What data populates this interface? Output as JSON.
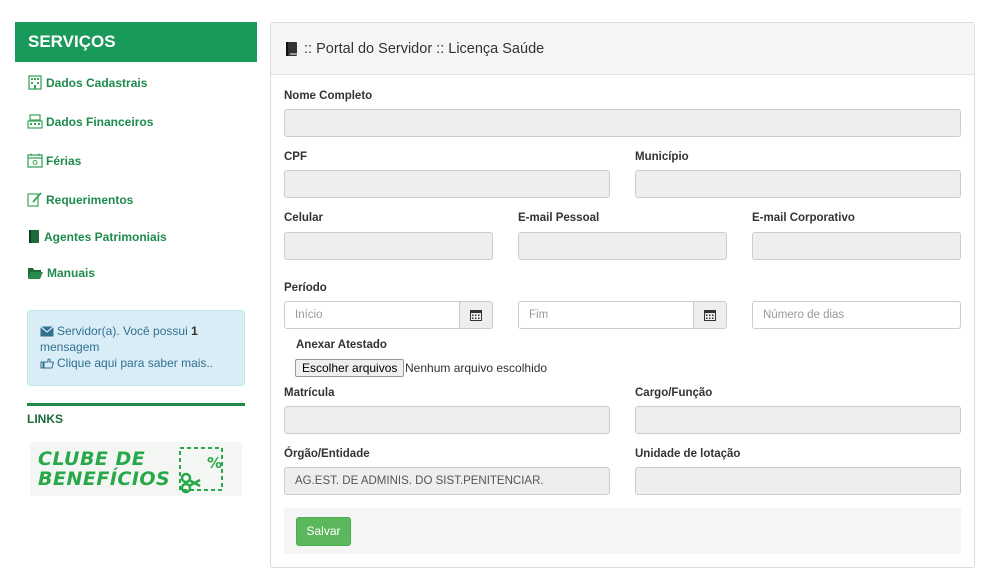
{
  "sidebar": {
    "title": "SERVIÇOS",
    "items": [
      {
        "label": "Dados Cadastrais",
        "icon": "building-icon"
      },
      {
        "label": "Dados Financeiros",
        "icon": "cash-register-icon"
      },
      {
        "label": "Férias",
        "icon": "calendar-icon"
      },
      {
        "label": "Requerimentos",
        "icon": "edit-document-icon"
      },
      {
        "label": "Agentes Patrimoniais",
        "icon": "book-icon"
      },
      {
        "label": "Manuais",
        "icon": "folder-open-icon"
      }
    ],
    "message": {
      "text_before": "Servidor(a). Você possui ",
      "count": "1",
      "text_after": "mensagem",
      "link": "Clique aqui para saber mais.."
    },
    "links_title": "LINKS",
    "banner": {
      "line1": "CLUBE DE",
      "line2": "BENEFÍCIOS"
    }
  },
  "panel": {
    "title": ":: Portal do Servidor :: Licença Saúde",
    "fields": {
      "nome_label": "Nome Completo",
      "cpf_label": "CPF",
      "municipio_label": "Município",
      "celular_label": "Celular",
      "email_pessoal_label": "E-mail Pessoal",
      "email_corp_label": "E-mail Corporativo",
      "periodo_label": "Período",
      "inicio_placeholder": "Início",
      "fim_placeholder": "Fim",
      "dias_placeholder": "Número de dias",
      "anexo_label": "Anexar Atestado",
      "file_button": "Escolher arquivos",
      "file_status": "Nenhum arquivo escolhido",
      "matricula_label": "Matrícula",
      "cargo_label": "Cargo/Função",
      "orgao_label": "Órgão/Entidade",
      "orgao_value": "AG.EST. DE ADMINIS. DO SIST.PENITENCIAR.",
      "unidade_label": "Unidade de lotação"
    },
    "save_label": "Salvar"
  },
  "colors": {
    "brand_green": "#1a9a5a",
    "save_green": "#5cb85c",
    "info_bg": "#d9edf7"
  }
}
